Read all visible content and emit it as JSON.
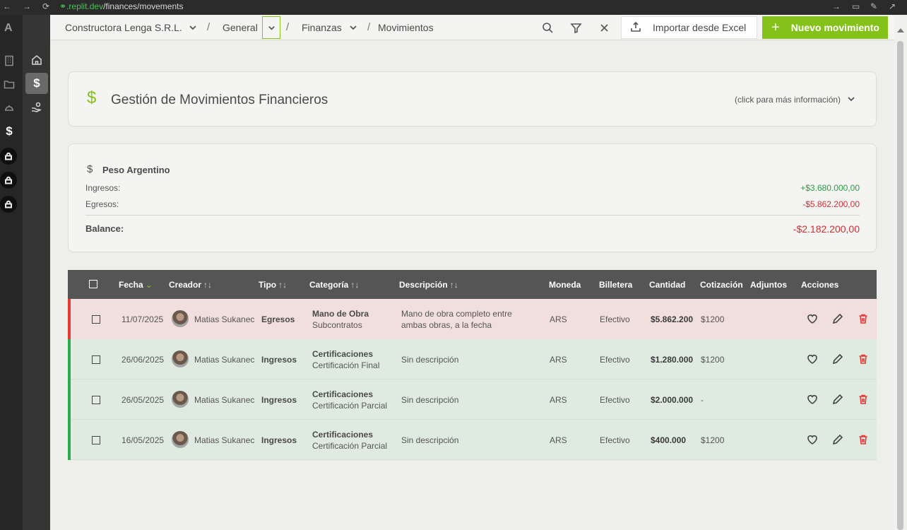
{
  "browser": {
    "url_host": ".replit.dev",
    "url_path": "/finances/movements"
  },
  "rail": {
    "logo": "A",
    "active_icon": "$"
  },
  "breadcrumb": {
    "org": "Constructora Lenga S.R.L.",
    "project": "General",
    "section": "Finanzas",
    "page": "Movimientos",
    "separator": "/"
  },
  "toolbar": {
    "import_label": "Importar desde Excel",
    "new_label": "Nuevo movimiento",
    "new_plus": "+"
  },
  "info": {
    "icon": "$",
    "title": "Gestión de Movimientos Financieros",
    "hint": "(click para más información)"
  },
  "balance": {
    "currency_icon": "$",
    "currency": "Peso Argentino",
    "income_label": "Ingresos:",
    "income_value": "+$3.680.000,00",
    "expense_label": "Egresos:",
    "expense_value": "-$5.862.200,00",
    "balance_label": "Balance:",
    "balance_value": "-$2.182.200,00"
  },
  "table": {
    "headers": {
      "fecha": "Fecha",
      "creador": "Creador",
      "tipo": "Tipo",
      "categoria": "Categoría",
      "descripcion": "Descripción",
      "moneda": "Moneda",
      "billetera": "Billetera",
      "cantidad": "Cantidad",
      "cotizacion": "Cotización",
      "adjuntos": "Adjuntos",
      "acciones": "Acciones"
    },
    "sort_icon": "↑↓",
    "sort_active_icon": "⌄",
    "rows": [
      {
        "fecha": "11/07/2025",
        "creador": "Matias Sukanec",
        "tipo": "Egresos",
        "categoria": "Mano de Obra",
        "subcategoria": "Subcontratos",
        "descripcion_1": "Mano de obra completo entre",
        "descripcion_2": "ambas obras, a la fecha",
        "moneda": "ARS",
        "billetera": "Efectivo",
        "cantidad": "$5.862.200",
        "cotizacion": "$1200"
      },
      {
        "fecha": "26/06/2025",
        "creador": "Matias Sukanec",
        "tipo": "Ingresos",
        "categoria": "Certificaciones",
        "subcategoria": "Certificación Final",
        "descripcion_1": "Sin descripción",
        "descripcion_2": "",
        "moneda": "ARS",
        "billetera": "Efectivo",
        "cantidad": "$1.280.000",
        "cotizacion": "$1200"
      },
      {
        "fecha": "26/05/2025",
        "creador": "Matias Sukanec",
        "tipo": "Ingresos",
        "categoria": "Certificaciones",
        "subcategoria": "Certificación Parcial",
        "descripcion_1": "Sin descripción",
        "descripcion_2": "",
        "moneda": "ARS",
        "billetera": "Efectivo",
        "cantidad": "$2.000.000",
        "cotizacion": "-"
      },
      {
        "fecha": "16/05/2025",
        "creador": "Matias Sukanec",
        "tipo": "Ingresos",
        "categoria": "Certificaciones",
        "subcategoria": "Certificación Parcial",
        "descripcion_1": "Sin descripción",
        "descripcion_2": "",
        "moneda": "ARS",
        "billetera": "Efectivo",
        "cantidad": "$400.000",
        "cotizacion": "$1200"
      }
    ]
  },
  "colors": {
    "accent": "#84c21a",
    "income": "#2e9a46",
    "expense": "#d32f2f",
    "egreso_bar": "#e53935",
    "ingreso_bar": "#2eaa4e"
  }
}
